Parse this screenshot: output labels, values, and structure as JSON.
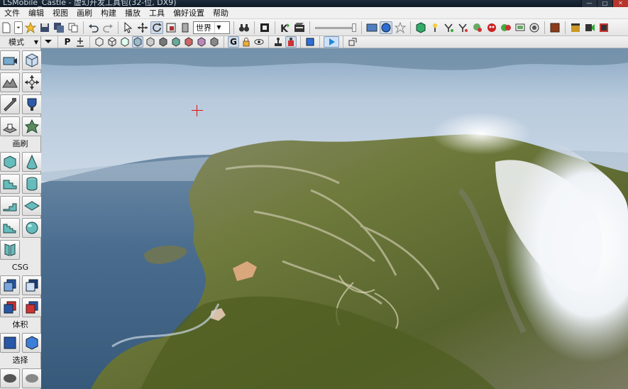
{
  "window": {
    "title": "LSMobile_Castle - 虚幻开发工具包(32-位, DX9)",
    "buttons": [
      "—",
      "□",
      "✕"
    ]
  },
  "menu": [
    "文件",
    "编辑",
    "视图",
    "画刷",
    "构建",
    "播放",
    "工具",
    "偏好设置",
    "帮助"
  ],
  "toolbar": {
    "coord_system": "世界"
  },
  "toolbar2": {
    "p_label": "P",
    "g_label": "G"
  },
  "left_panel": {
    "mode_label": "模式",
    "sections": {
      "brush": "画刷",
      "csg": "CSG",
      "volume": "体积",
      "select": "选择"
    }
  },
  "colors": {
    "ocean": "#3f6688",
    "sky": "#c7d6e8",
    "terrain": "#6f7a3c",
    "snow": "#eef2f6",
    "crosshair": "#e01010"
  }
}
